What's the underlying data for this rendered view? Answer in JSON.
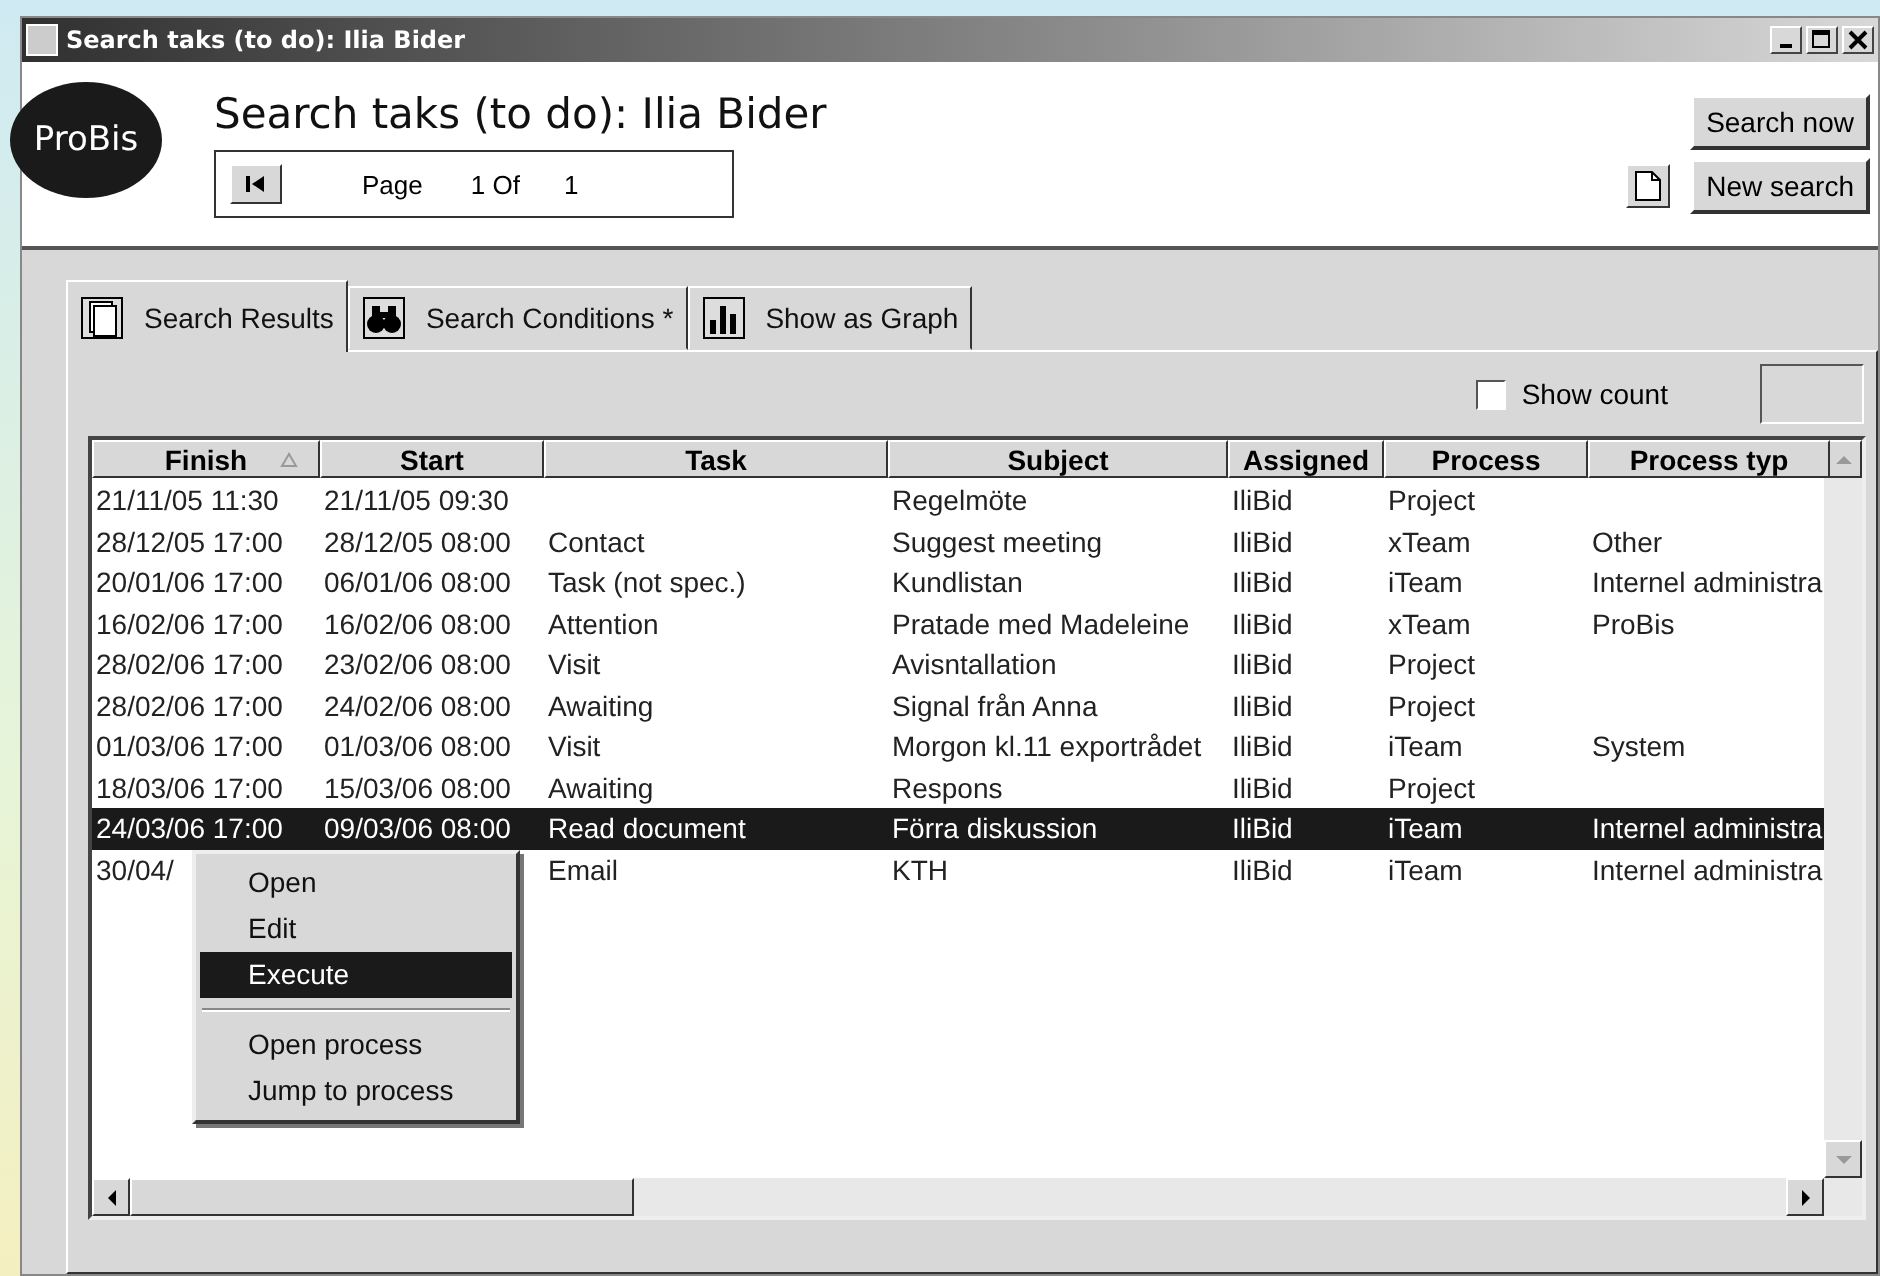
{
  "window": {
    "title": "Search taks (to do): Ilia Bider"
  },
  "header": {
    "logo": "ProBis",
    "title": "Search taks (to do): Ilia Bider",
    "pager": {
      "label": "Page",
      "current": "1 Of",
      "total": "1"
    }
  },
  "buttons": [
    {
      "label": "Search now"
    },
    {
      "label": "New search"
    }
  ],
  "tabs": [
    {
      "label": "Search Results",
      "selected": true
    },
    {
      "label": "Search Conditions *",
      "selected": false
    },
    {
      "label": "Show as Graph",
      "selected": false
    }
  ],
  "show_count": {
    "label": "Show count",
    "checked": false
  },
  "table": {
    "columns": [
      "Finish",
      "Start",
      "Task",
      "Subject",
      "Assigned",
      "Process",
      "Process typ"
    ],
    "rows": [
      {
        "cells": [
          "21/11/05 11:30",
          "21/11/05 09:30",
          null,
          "Regelmöte",
          "IliBid",
          "Project",
          null
        ],
        "selected": false
      },
      {
        "cells": [
          "28/12/05 17:00",
          "28/12/05 08:00",
          "Contact",
          "Suggest meeting",
          "IliBid",
          "xTeam",
          "Other"
        ],
        "selected": false
      },
      {
        "cells": [
          "20/01/06 17:00",
          "06/01/06 08:00",
          "Task (not spec.)",
          "Kundlistan",
          "IliBid",
          "iTeam",
          "Internel administra"
        ],
        "selected": false
      },
      {
        "cells": [
          "16/02/06 17:00",
          "16/02/06 08:00",
          "Attention",
          "Pratade med Madeleine",
          "IliBid",
          "xTeam",
          "ProBis"
        ],
        "selected": false
      },
      {
        "cells": [
          "28/02/06 17:00",
          "23/02/06 08:00",
          "Visit",
          "Avisntallation",
          "IliBid",
          "Project",
          null
        ],
        "selected": false
      },
      {
        "cells": [
          "28/02/06 17:00",
          "24/02/06 08:00",
          "Awaiting",
          "Signal från Anna",
          "IliBid",
          "Project",
          null
        ],
        "selected": false
      },
      {
        "cells": [
          "01/03/06 17:00",
          "01/03/06 08:00",
          "Visit",
          "Morgon kl.11 exportrådet",
          "IliBid",
          "iTeam",
          "System"
        ],
        "selected": false
      },
      {
        "cells": [
          "18/03/06 17:00",
          "15/03/06 08:00",
          "Awaiting",
          "Respons",
          "IliBid",
          "Project",
          null
        ],
        "selected": false
      },
      {
        "cells": [
          "24/03/06 17:00",
          "09/03/06 08:00",
          "Read document",
          "Förra diskussion",
          "IliBid",
          "iTeam",
          "Internel administra"
        ],
        "selected": true
      },
      {
        "cells": [
          "30/04/",
          null,
          "Email",
          "KTH",
          "IliBid",
          "iTeam",
          "Internel administra"
        ],
        "selected": false
      }
    ]
  },
  "context_menu": {
    "items": [
      {
        "kind": "item",
        "label": "Open",
        "selected": false
      },
      {
        "kind": "item",
        "label": "Edit",
        "selected": false
      },
      {
        "kind": "item",
        "label": "Execute",
        "selected": true
      },
      {
        "kind": "separator"
      },
      {
        "kind": "item",
        "label": "Open process",
        "selected": false
      },
      {
        "kind": "item",
        "label": "Jump to process",
        "selected": false
      }
    ]
  }
}
